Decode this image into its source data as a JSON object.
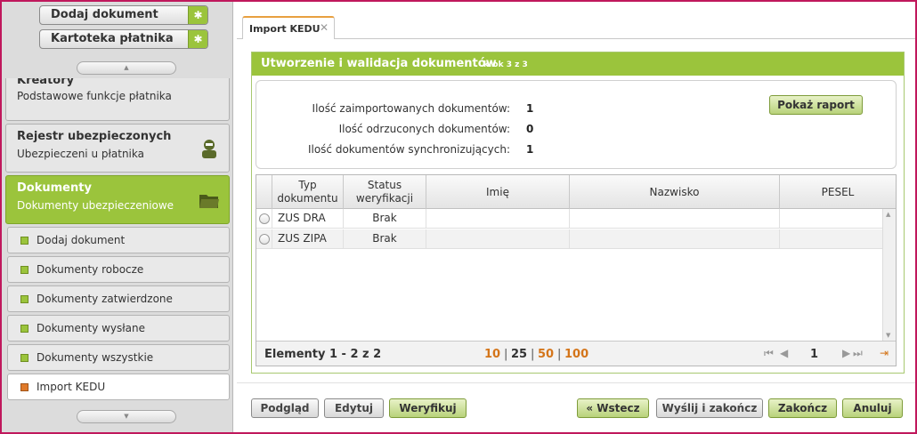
{
  "sidebar": {
    "quick": [
      {
        "label": "Dodaj dokument"
      },
      {
        "label": "Kartoteka płatnika"
      }
    ],
    "panels": [
      {
        "title": "Kreatory",
        "subtitle": "Podstawowe funkcje płatnika"
      },
      {
        "title": "Rejestr ubezpieczonych",
        "subtitle": "Ubezpieczeni u płatnika"
      },
      {
        "title": "Dokumenty",
        "subtitle": "Dokumenty ubezpieczeniowe"
      }
    ],
    "items": [
      {
        "label": "Dodaj dokument"
      },
      {
        "label": "Dokumenty robocze"
      },
      {
        "label": "Dokumenty zatwierdzone"
      },
      {
        "label": "Dokumenty wysłane"
      },
      {
        "label": "Dokumenty wszystkie"
      },
      {
        "label": "Import KEDU"
      }
    ]
  },
  "tab": {
    "label": "Import KEDU",
    "close": "✕"
  },
  "main": {
    "title": "Utworzenie i walidacja dokumentów",
    "step": "krok 3 z 3",
    "stats": [
      {
        "label": "Ilość zaimportowanych dokumentów:",
        "value": "1"
      },
      {
        "label": "Ilość odrzuconych dokumentów:",
        "value": "0"
      },
      {
        "label": "Ilość dokumentów synchronizujących:",
        "value": "1"
      }
    ],
    "report_button": "Pokaż raport"
  },
  "grid": {
    "columns": [
      {
        "label": "Typ dokumentu"
      },
      {
        "label": "Status weryfikacji"
      },
      {
        "label": "Imię"
      },
      {
        "label": "Nazwisko"
      },
      {
        "label": "PESEL"
      }
    ],
    "rows": [
      {
        "type": "ZUS DRA",
        "status": "Brak",
        "first": "",
        "last": "",
        "pesel": ""
      },
      {
        "type": "ZUS ZIPA",
        "status": "Brak",
        "first": "",
        "last": "",
        "pesel": ""
      }
    ],
    "footer": {
      "elements": "Elementy 1 - 2 z 2",
      "page_sizes": [
        "10",
        "25",
        "50",
        "100"
      ],
      "separator": "|",
      "page": "1"
    }
  },
  "buttons": {
    "preview": "Podgląd",
    "edit": "Edytuj",
    "verify": "Weryfikuj",
    "back": "« Wstecz",
    "send_finish": "Wyślij i zakończ",
    "finish": "Zakończ",
    "cancel": "Anuluj"
  },
  "colors": {
    "accent": "#9bc43c",
    "frame": "#c0185c",
    "link": "#d4751a"
  }
}
